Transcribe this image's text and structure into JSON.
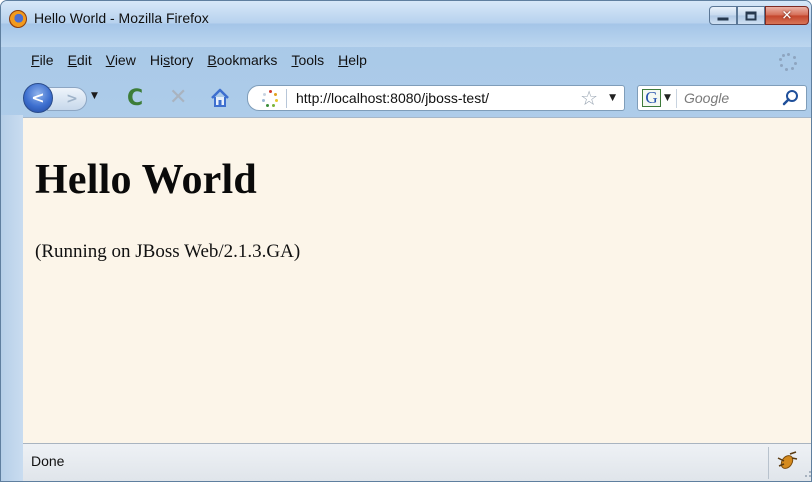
{
  "window": {
    "title": "Hello World - Mozilla Firefox",
    "minimize_icon": "minimize-icon",
    "maximize_icon": "maximize-icon",
    "close_icon": "close-icon",
    "close_glyph": "✕"
  },
  "menubar": {
    "items": [
      {
        "label_u": "F",
        "label_rest": "ile"
      },
      {
        "label_u": "E",
        "label_rest": "dit"
      },
      {
        "label_u": "V",
        "label_rest": "iew"
      },
      {
        "label_pre": "Hi",
        "label_u": "s",
        "label_rest": "tory"
      },
      {
        "label_u": "B",
        "label_rest": "ookmarks"
      },
      {
        "label_u": "T",
        "label_rest": "ools"
      },
      {
        "label_u": "H",
        "label_rest": "elp"
      }
    ]
  },
  "navbar": {
    "back_glyph": "<",
    "forward_glyph": ">",
    "dropdown_glyph": "▼",
    "reload_glyph": "C",
    "stop_glyph": "✕",
    "url": "http://localhost:8080/jboss-test/",
    "star_glyph": "☆",
    "search_engine_glyph": "G",
    "search_placeholder": "Google"
  },
  "page": {
    "heading": "Hello World",
    "text": "(Running on JBoss Web/2.1.3.GA)"
  },
  "statusbar": {
    "status_text": "Done"
  },
  "colors": {
    "content_bg": "#fcf5e9",
    "frame": "#bcd7ef",
    "close_button": "#c3432a"
  }
}
